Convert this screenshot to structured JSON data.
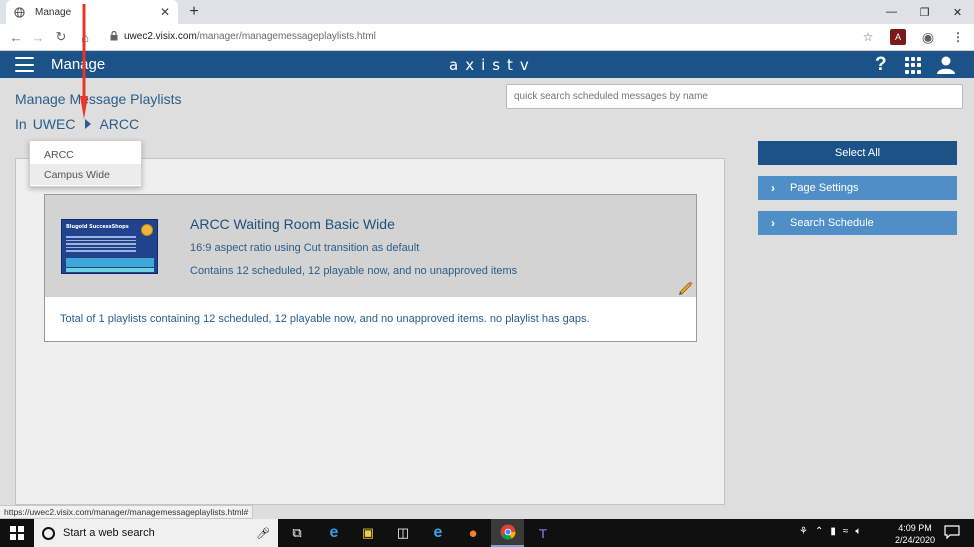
{
  "browser": {
    "tab_title": "Manage",
    "tab_close": "✕",
    "new_tab": "+",
    "url_host": "uwec2.visix.com",
    "url_path": "/manager/managemessageplaylists.html",
    "status_url": "https://uwec2.visix.com/manager/managemessageplaylists.html#"
  },
  "app": {
    "title": "Manage",
    "logo_text": "axistv",
    "help_label": "?"
  },
  "page": {
    "title": "Manage Message Playlists",
    "breadcrumb_prefix": "In",
    "breadcrumb_root": "UWEC",
    "breadcrumb_current": "ARCC",
    "search_placeholder": "quick search scheduled messages by name"
  },
  "dropdown": {
    "items": [
      "ARCC",
      "Campus Wide"
    ]
  },
  "playlist": {
    "title": "ARCC Waiting Room Basic Wide",
    "aspect": "16:9 aspect ratio using Cut transition as default",
    "contents": "Contains 12 scheduled, 12 playable now, and no unapproved items",
    "thumb_title": "Blugold SuccessShops"
  },
  "summary": "Total of 1 playlists containing 12 scheduled, 12 playable now, and no unapproved items. no playlist has gaps.",
  "actions": {
    "select_all": "Select All",
    "page_settings": "Page Settings",
    "search_schedule": "Search Schedule"
  },
  "taskbar": {
    "search_placeholder": "Start a web search",
    "time": "4:09 PM",
    "date": "2/24/2020"
  },
  "colors": {
    "header": "#1b5389",
    "button_primary": "#1b5389",
    "button_secondary": "#4f8ec6",
    "text_link": "#2a5d8a",
    "annotation_arrow": "#e8362a"
  },
  "icons": {
    "nav": [
      "back-icon",
      "forward-icon",
      "reload-icon",
      "home-icon"
    ],
    "toolbar": [
      "star-icon",
      "pdf-icon",
      "profile-icon",
      "menu-icon"
    ],
    "taskbar": [
      "task-view-icon",
      "edge-icon",
      "file-explorer-icon",
      "store-icon",
      "ie-icon",
      "firefox-icon",
      "chrome-icon",
      "teams-icon"
    ]
  }
}
